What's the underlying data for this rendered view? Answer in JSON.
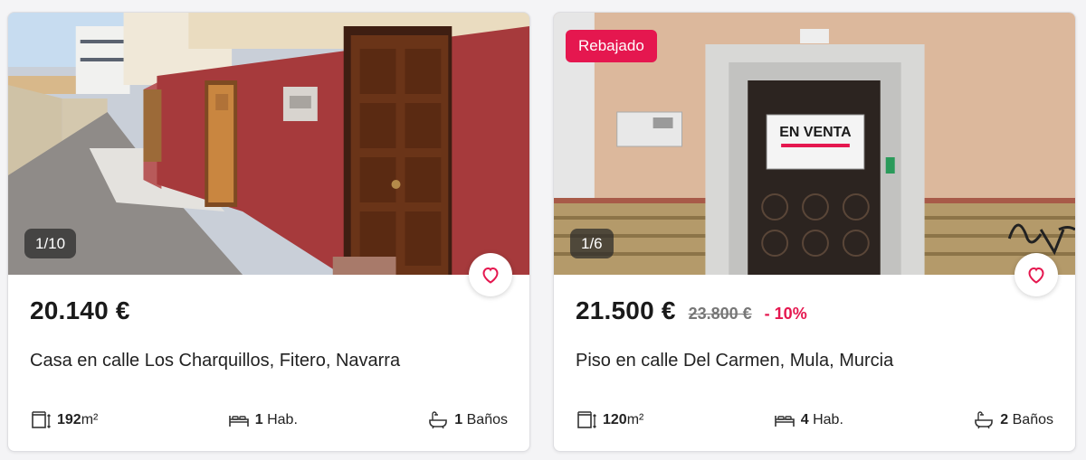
{
  "listings": [
    {
      "image_counter": "1/10",
      "promo_badge": "",
      "price": "20.140 €",
      "old_price": "",
      "discount": "",
      "title": "Casa en calle Los Charquillos, Fitero, Navarra",
      "features": {
        "area": {
          "value": "192",
          "unit": "m²",
          "icon": "area-icon"
        },
        "rooms": {
          "value": "1",
          "unit": "Hab.",
          "icon": "bed-icon"
        },
        "baths": {
          "value": "1",
          "unit": "Baños",
          "icon": "bathtub-icon"
        }
      }
    },
    {
      "image_counter": "1/6",
      "promo_badge": "Rebajado",
      "price": "21.500 €",
      "old_price": "23.800 €",
      "discount": "- 10%",
      "title": "Piso en calle Del Carmen, Mula, Murcia",
      "sign_text": "EN VENTA",
      "features": {
        "area": {
          "value": "120",
          "unit": "m²",
          "icon": "area-icon"
        },
        "rooms": {
          "value": "4",
          "unit": "Hab.",
          "icon": "bed-icon"
        },
        "baths": {
          "value": "2",
          "unit": "Baños",
          "icon": "bathtub-icon"
        }
      }
    }
  ],
  "colors": {
    "accent": "#e5174f",
    "text": "#1a1a1a",
    "muted": "#777777"
  }
}
